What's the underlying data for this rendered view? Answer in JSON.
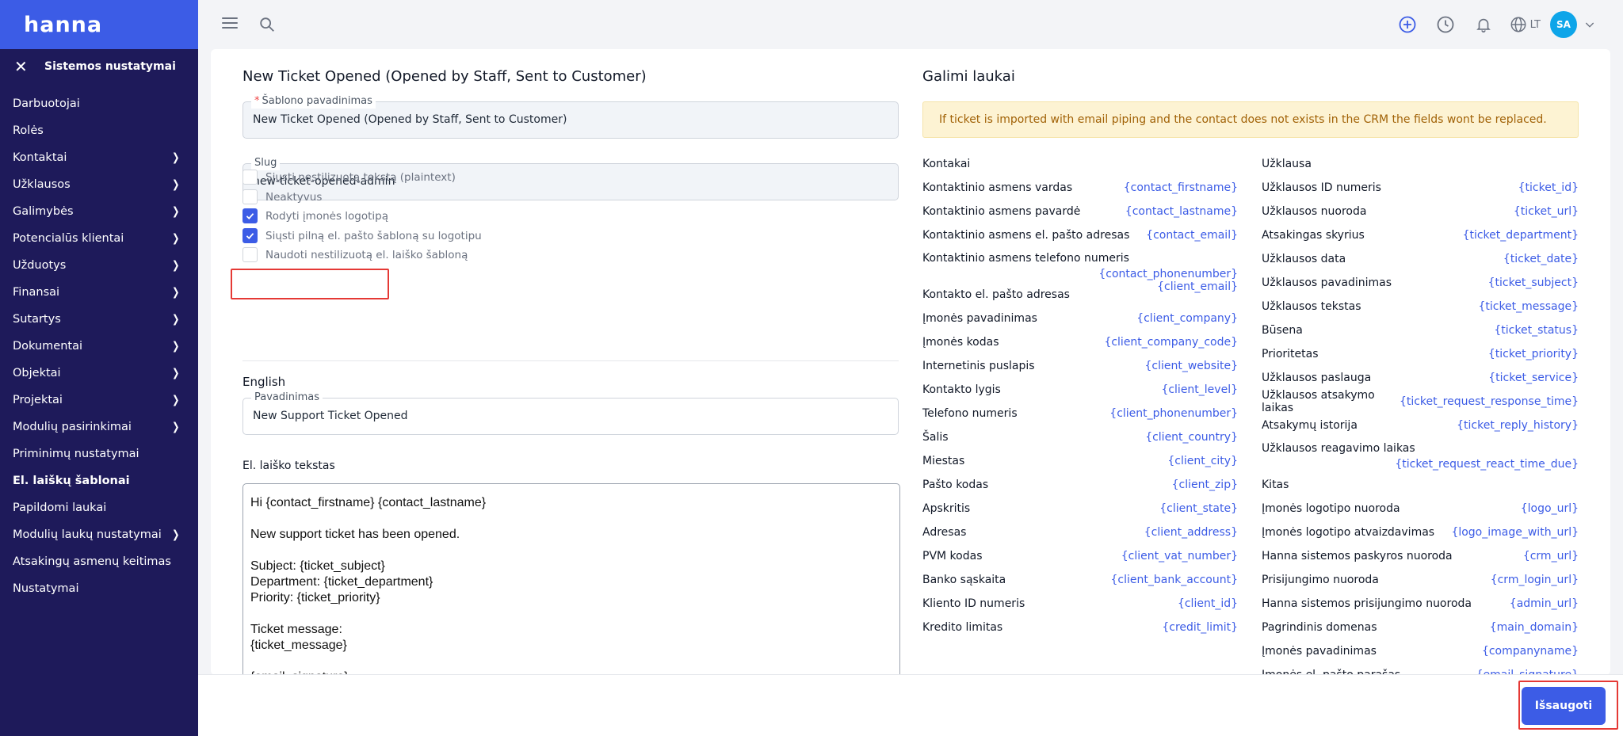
{
  "brand": "hanna",
  "sidebar": {
    "section_title": "Sistemos nustatymai",
    "items": [
      {
        "label": "Darbuotojai",
        "chevron": false,
        "active": false
      },
      {
        "label": "Rolės",
        "chevron": false,
        "active": false
      },
      {
        "label": "Kontaktai",
        "chevron": true,
        "active": false
      },
      {
        "label": "Užklausos",
        "chevron": true,
        "active": false
      },
      {
        "label": "Galimybės",
        "chevron": true,
        "active": false
      },
      {
        "label": "Potencialūs klientai",
        "chevron": true,
        "active": false
      },
      {
        "label": "Užduotys",
        "chevron": true,
        "active": false
      },
      {
        "label": "Finansai",
        "chevron": true,
        "active": false
      },
      {
        "label": "Sutartys",
        "chevron": true,
        "active": false
      },
      {
        "label": "Dokumentai",
        "chevron": true,
        "active": false
      },
      {
        "label": "Objektai",
        "chevron": true,
        "active": false
      },
      {
        "label": "Projektai",
        "chevron": true,
        "active": false
      },
      {
        "label": "Modulių pasirinkimai",
        "chevron": true,
        "active": false
      },
      {
        "label": "Priminimų nustatymai",
        "chevron": false,
        "active": false
      },
      {
        "label": "El. laiškų šablonai",
        "chevron": false,
        "active": true
      },
      {
        "label": "Papildomi laukai",
        "chevron": false,
        "active": false
      },
      {
        "label": "Modulių laukų nustatymai",
        "chevron": true,
        "active": false
      },
      {
        "label": "Atsakingų asmenų keitimas",
        "chevron": false,
        "active": false
      },
      {
        "label": "Nustatymai",
        "chevron": false,
        "active": false
      }
    ]
  },
  "header": {
    "language": "LT",
    "avatar_initials": "SA",
    "icons": [
      "menu-icon",
      "search-icon",
      "add-circle-icon",
      "clock-icon",
      "bell-icon",
      "globe-icon",
      "chevron-down-icon"
    ]
  },
  "form": {
    "title": "New Ticket Opened (Opened by Staff, Sent to Customer)",
    "template_name_label": "Šablono pavadinimas",
    "template_name_value": "New Ticket Opened (Opened by Staff, Sent to Customer)",
    "slug_label": "Slug",
    "slug_value": "new-ticket-opened-admin",
    "checkboxes": [
      {
        "label": "Siųsti nestilizuotą tekstą (plaintext)",
        "checked": false
      },
      {
        "label": "Neaktyvus",
        "checked": false
      },
      {
        "label": "Rodyti įmonės logotipą",
        "checked": true
      },
      {
        "label": "Siųsti pilną el. pašto šabloną su logotipu",
        "checked": true
      },
      {
        "label": "Naudoti nestilizuotą el. laiško šabloną",
        "checked": false
      }
    ],
    "language_section": "English",
    "subject_label": "Pavadinimas",
    "subject_value": "New Support Ticket Opened",
    "body_label": "El. laiško tekstas",
    "body_lines": [
      "Hi {contact_firstname} {contact_lastname}",
      "",
      "New support ticket has been opened.",
      "",
      "Subject: {ticket_subject}",
      "Department: {ticket_department}",
      "Priority: {ticket_priority}",
      "",
      "Ticket message:",
      "{ticket_message}",
      "",
      "{email_signature}"
    ]
  },
  "merge_fields": {
    "title": "Galimi laukai",
    "notice": "If ticket is imported with email piping and the contact does not exists in the CRM the fields wont be replaced.",
    "left_groups": [
      {
        "group": "Kontakai",
        "fields": [
          {
            "key": "Kontaktinio asmens vardas",
            "value": "{contact_firstname}"
          },
          {
            "key": "Kontaktinio asmens pavardė",
            "value": "{contact_lastname}"
          },
          {
            "key": "Kontaktinio asmens el. pašto adresas",
            "value": "{contact_email}"
          },
          {
            "key": "Kontaktinio asmens telefono numeris",
            "value": "{contact_phonenumber}",
            "layout": "wrap"
          },
          {
            "key": "Kontakto el. pašto adresas",
            "value": "{client_email}",
            "layout": "up"
          },
          {
            "key": "Įmonės pavadinimas",
            "value": "{client_company}"
          },
          {
            "key": "Įmonės kodas",
            "value": "{client_company_code}"
          },
          {
            "key": "Internetinis puslapis",
            "value": "{client_website}"
          },
          {
            "key": "Kontakto lygis",
            "value": "{client_level}"
          },
          {
            "key": "Telefono numeris",
            "value": "{client_phonenumber}"
          },
          {
            "key": "Šalis",
            "value": "{client_country}"
          },
          {
            "key": "Miestas",
            "value": "{client_city}"
          },
          {
            "key": "Pašto kodas",
            "value": "{client_zip}"
          },
          {
            "key": "Apskritis",
            "value": "{client_state}"
          },
          {
            "key": "Adresas",
            "value": "{client_address}"
          },
          {
            "key": "PVM kodas",
            "value": "{client_vat_number}"
          },
          {
            "key": "Banko sąskaita",
            "value": "{client_bank_account}"
          },
          {
            "key": "Kliento ID numeris",
            "value": "{client_id}"
          },
          {
            "key": "Kredito limitas",
            "value": "{credit_limit}"
          }
        ]
      }
    ],
    "right_groups": [
      {
        "group": "Užklausa",
        "fields": [
          {
            "key": "Užklausos ID numeris",
            "value": "{ticket_id}"
          },
          {
            "key": "Užklausos nuoroda",
            "value": "{ticket_url}"
          },
          {
            "key": "Atsakingas skyrius",
            "value": "{ticket_department}"
          },
          {
            "key": "Užklausos data",
            "value": "{ticket_date}"
          },
          {
            "key": "Užklausos pavadinimas",
            "value": "{ticket_subject}"
          },
          {
            "key": "Užklausos tekstas",
            "value": "{ticket_message}"
          },
          {
            "key": "Būsena",
            "value": "{ticket_status}"
          },
          {
            "key": "Prioritetas",
            "value": "{ticket_priority}"
          },
          {
            "key": "Užklausos paslauga",
            "value": "{ticket_service}"
          },
          {
            "key": "Užklausos atsakymo laikas",
            "value": "{ticket_request_response_time}"
          },
          {
            "key": "Atsakymų istorija",
            "value": "{ticket_reply_history}"
          },
          {
            "key": "Užklausos reagavimo laikas",
            "value": "{ticket_request_react_time_due}",
            "layout": "wrap"
          }
        ]
      },
      {
        "group": "Kitas",
        "fields": [
          {
            "key": "Įmonės logotipo nuoroda",
            "value": "{logo_url}"
          },
          {
            "key": "Įmonės logotipo atvaizdavimas",
            "value": "{logo_image_with_url}"
          },
          {
            "key": "Hanna sistemos paskyros nuoroda",
            "value": "{crm_url}"
          },
          {
            "key": "Prisijungimo nuoroda",
            "value": "{crm_login_url}"
          },
          {
            "key": "Hanna sistemos prisijungimo nuoroda",
            "value": "{admin_url}"
          },
          {
            "key": "Pagrindinis domenas",
            "value": "{main_domain}"
          },
          {
            "key": "Įmonės pavadinimas",
            "value": "{companyname}"
          },
          {
            "key": "Įmonės el. pašto parašas",
            "value": "{email_signature}"
          }
        ]
      }
    ]
  },
  "footer": {
    "save_label": "Išsaugoti"
  },
  "colors": {
    "sidebar_bg": "#1e1a5a",
    "brand_bg": "#3c5ce6",
    "accent": "#3c5ce6",
    "notice_bg": "#fdf3d3",
    "highlight": "#e53935"
  }
}
